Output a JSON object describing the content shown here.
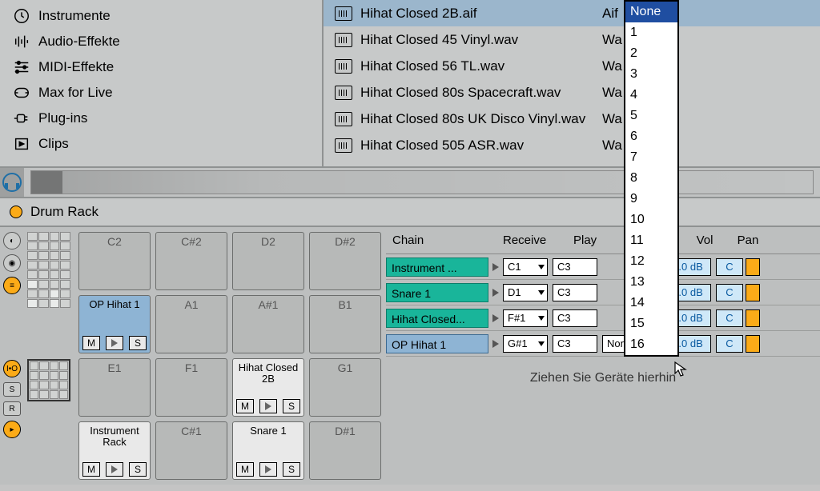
{
  "categories": [
    {
      "label": "Instrumente",
      "icon": "clock"
    },
    {
      "label": "Audio-Effekte",
      "icon": "eq"
    },
    {
      "label": "MIDI-Effekte",
      "icon": "sliders"
    },
    {
      "label": "Max for Live",
      "icon": "max"
    },
    {
      "label": "Plug-ins",
      "icon": "plug"
    },
    {
      "label": "Clips",
      "icon": "clip"
    }
  ],
  "files": [
    {
      "name": "Hihat Closed 2B.aif",
      "type": "Aif",
      "selected": true
    },
    {
      "name": "Hihat Closed 45 Vinyl.wav",
      "type": "Wa"
    },
    {
      "name": "Hihat Closed 56 TL.wav",
      "type": "Wa"
    },
    {
      "name": "Hihat Closed 80s Spacecraft.wav",
      "type": "Wa"
    },
    {
      "name": "Hihat Closed 80s UK Disco Vinyl.wav",
      "type": "Wa"
    },
    {
      "name": "Hihat Closed 505 ASR.wav",
      "type": "Wa"
    }
  ],
  "device": {
    "title": "Drum Rack"
  },
  "pads": {
    "row0": [
      "C2",
      "C#2",
      "D2",
      "D#2"
    ],
    "row1": [
      "OP Hihat 1",
      "A1",
      "A#1",
      "B1"
    ],
    "row2": [
      "E1",
      "F1",
      "Hihat Closed 2B",
      "G1"
    ],
    "row3": [
      "Instrument Rack",
      "C#1",
      "Snare 1",
      "D#1"
    ]
  },
  "headers": {
    "chain": "Chain",
    "recv": "Receive",
    "play": "Play",
    "vol": "Vol",
    "pan": "Pan"
  },
  "chains": [
    {
      "name": "Instrument ...",
      "recv": "C1",
      "play": "C3",
      "choke": "",
      "vol": "0.0 dB",
      "pan": "C"
    },
    {
      "name": "Snare 1",
      "recv": "D1",
      "play": "C3",
      "choke": "",
      "vol": "0.0 dB",
      "pan": "C"
    },
    {
      "name": "Hihat Closed...",
      "recv": "F#1",
      "play": "C3",
      "choke": "",
      "vol": "0.0 dB",
      "pan": "C"
    },
    {
      "name": "OP Hihat 1",
      "recv": "G#1",
      "play": "C3",
      "choke": "None",
      "vol": "0.0 dB",
      "pan": "C",
      "selected": true
    }
  ],
  "drop_hint": "Ziehen Sie Geräte hierhin",
  "choke_menu": [
    "None",
    "1",
    "2",
    "3",
    "4",
    "5",
    "6",
    "7",
    "8",
    "9",
    "10",
    "11",
    "12",
    "13",
    "14",
    "15",
    "16"
  ],
  "choke_selected": "None",
  "ms": {
    "m": "M",
    "s": "S"
  }
}
